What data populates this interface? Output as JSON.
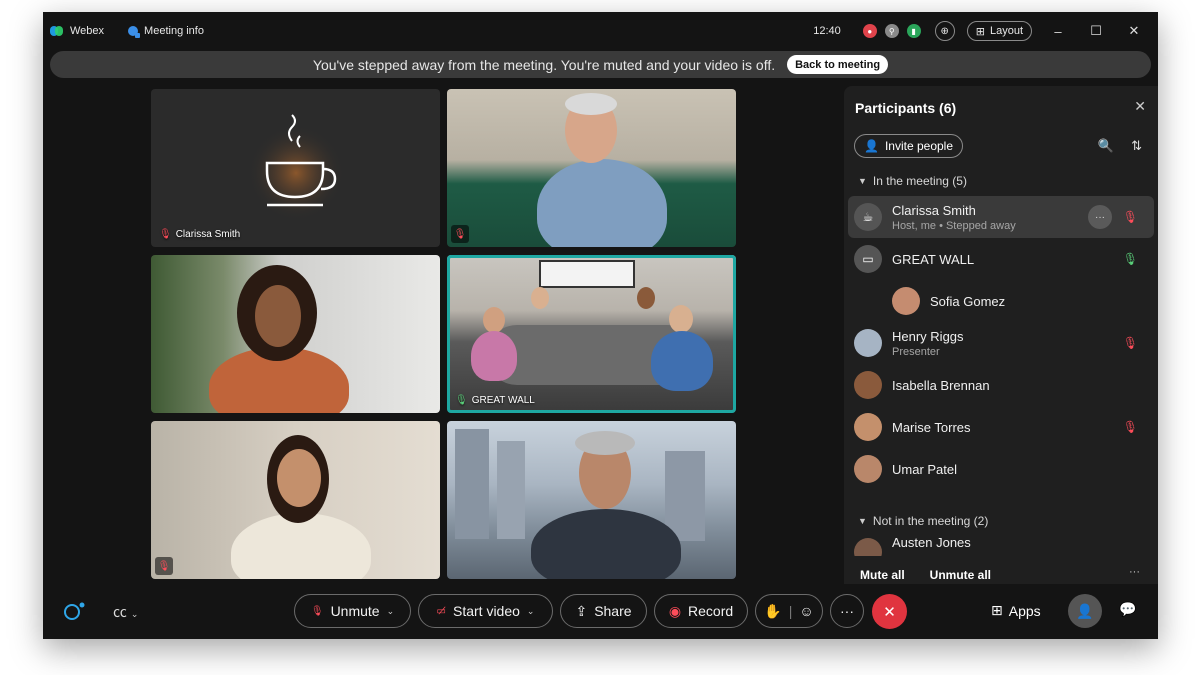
{
  "titlebar": {
    "app_name": "Webex",
    "meeting_info": "Meeting info",
    "time": "12:40",
    "layout_label": "Layout"
  },
  "banner": {
    "message": "You've stepped away from the meeting. You're muted and your video is off.",
    "back_button": "Back to meeting"
  },
  "tiles": {
    "clarissa": "Clarissa Smith",
    "great_wall": "GREAT WALL"
  },
  "participants": {
    "title": "Participants (6)",
    "invite": "Invite people",
    "in_meeting": "In the meeting (5)",
    "not_in_meeting": "Not in the meeting (2)",
    "items": [
      {
        "name": "Clarissa Smith",
        "sub": "Host, me • Stepped away"
      },
      {
        "name": "GREAT WALL",
        "sub": ""
      },
      {
        "name": "Sofia Gomez",
        "sub": ""
      },
      {
        "name": "Henry Riggs",
        "sub": "Presenter"
      },
      {
        "name": "Isabella Brennan",
        "sub": ""
      },
      {
        "name": "Marise Torres",
        "sub": ""
      },
      {
        "name": "Umar Patel",
        "sub": ""
      },
      {
        "name": "Austen Jones",
        "sub": ""
      }
    ],
    "mute_all": "Mute all",
    "unmute_all": "Unmute all"
  },
  "controls": {
    "unmute": "Unmute",
    "start_video": "Start video",
    "share": "Share",
    "record": "Record",
    "apps": "Apps"
  },
  "colors": {
    "accent_teal": "#1ea7a2",
    "end_call": "#e0343f",
    "muted_red": "#ff4d5a",
    "mic_green": "#5ad07a"
  }
}
